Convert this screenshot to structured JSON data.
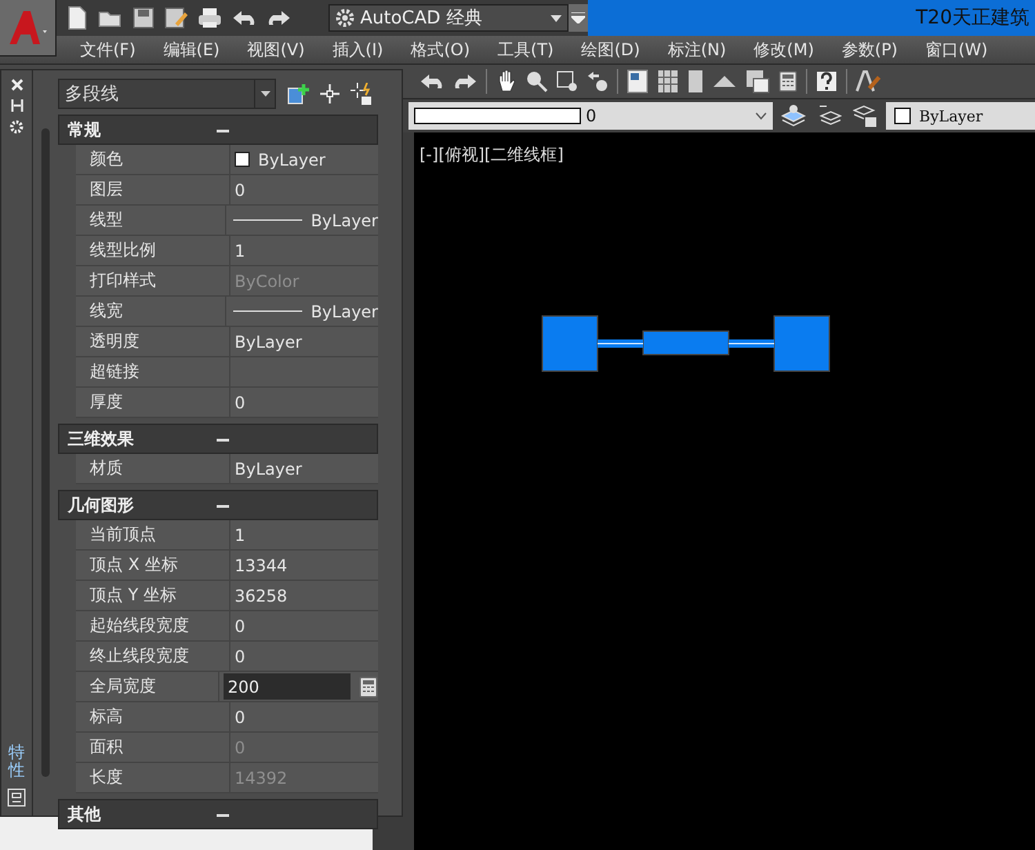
{
  "title_bar": {
    "workspace": "AutoCAD 经典",
    "app_title": "T20天正建筑"
  },
  "menu": [
    {
      "label": "文件(F)"
    },
    {
      "label": "编辑(E)"
    },
    {
      "label": "视图(V)"
    },
    {
      "label": "插入(I)"
    },
    {
      "label": "格式(O)"
    },
    {
      "label": "工具(T)"
    },
    {
      "label": "绘图(D)"
    },
    {
      "label": "标注(N)"
    },
    {
      "label": "修改(M)"
    },
    {
      "label": "参数(P)"
    },
    {
      "label": "窗口(W)"
    }
  ],
  "layer_bar": {
    "layer": "0",
    "color_setting": "ByLayer"
  },
  "properties": {
    "object_type": "多段线",
    "tab_label": "特性",
    "sections": [
      {
        "title": "常规",
        "expanded": true,
        "rows": [
          {
            "name": "颜色",
            "value": "ByLayer",
            "kind": "color",
            "disabled": false
          },
          {
            "name": "图层",
            "value": "0",
            "kind": "text",
            "disabled": false
          },
          {
            "name": "线型",
            "value": "ByLayer",
            "kind": "line",
            "disabled": false
          },
          {
            "name": "线型比例",
            "value": "1",
            "kind": "text",
            "disabled": false
          },
          {
            "name": "打印样式",
            "value": "ByColor",
            "kind": "text",
            "disabled": true
          },
          {
            "name": "线宽",
            "value": "ByLayer",
            "kind": "line",
            "disabled": false
          },
          {
            "name": "透明度",
            "value": "ByLayer",
            "kind": "text",
            "disabled": false
          },
          {
            "name": "超链接",
            "kind": "text"
          },
          {
            "name": "厚度",
            "value": "0",
            "kind": "text",
            "disabled": false
          }
        ]
      },
      {
        "title": "三维效果",
        "expanded": true,
        "rows": [
          {
            "name": "材质",
            "value": "ByLayer",
            "kind": "text",
            "disabled": false
          }
        ]
      },
      {
        "title": "几何图形",
        "expanded": true,
        "rows": [
          {
            "name": "当前顶点",
            "value": "1",
            "kind": "text",
            "disabled": false
          },
          {
            "name": "顶点 X 坐标",
            "value": "13344",
            "kind": "text",
            "disabled": false
          },
          {
            "name": "顶点 Y 坐标",
            "value": "36258",
            "kind": "text",
            "disabled": false
          },
          {
            "name": "起始线段宽度",
            "value": "0",
            "kind": "text",
            "disabled": false
          },
          {
            "name": "终止线段宽度",
            "value": "0",
            "kind": "text",
            "disabled": false
          },
          {
            "name": "全局宽度",
            "value": "200",
            "kind": "field",
            "disabled": false
          },
          {
            "name": "标高",
            "value": "0",
            "kind": "text",
            "disabled": false
          },
          {
            "name": "面积",
            "value": "0",
            "kind": "text",
            "disabled": true
          },
          {
            "name": "长度",
            "value": "14392",
            "kind": "text",
            "disabled": true
          }
        ]
      },
      {
        "title": "其他",
        "expanded": true
      }
    ]
  },
  "viewport": {
    "label": "[-][俯视][二维线框]"
  }
}
